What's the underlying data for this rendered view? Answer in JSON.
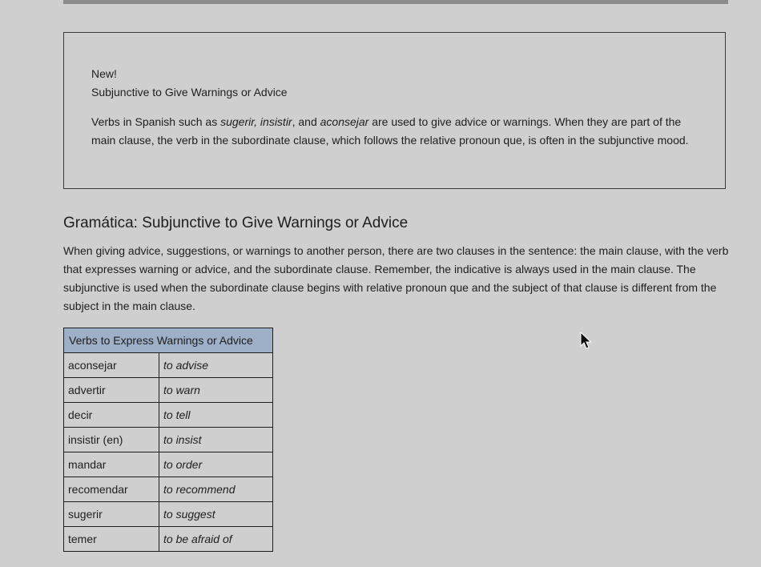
{
  "notice": {
    "badge": "New!",
    "title": "Subjunctive to Give Warnings or Advice",
    "body_intro": "Verbs in Spanish such as ",
    "verb1": "sugerir,",
    "sep1": " ",
    "verb2": "insistir",
    "sep2": ", and ",
    "verb3": "aconsejar",
    "body_mid": " are used to give advice or warnings. When they are part of the main clause, the verb in the subordinate clause, which follows the relative pronoun ",
    "pronoun": "que",
    "body_end": ", is often in the subjunctive mood."
  },
  "grammar": {
    "heading": "Gramática: Subjunctive to Give Warnings or Advice",
    "paragraph_start": "When giving advice, suggestions, or warnings to another person, there are two clauses in the sentence: the main clause, with the verb that expresses warning or advice, and the subordinate clause. Remember, the indicative is always used in the main clause. The subjunctive is used when the subordinate clause begins with relative pronoun ",
    "pronoun": "que",
    "paragraph_end": " and the subject of that clause is different from the subject in the main clause."
  },
  "table": {
    "header": "Verbs to Express Warnings or Advice",
    "rows": [
      {
        "spanish": "aconsejar",
        "english": "to advise"
      },
      {
        "spanish": "advertir",
        "english": "to warn"
      },
      {
        "spanish": "decir",
        "english": "to tell"
      },
      {
        "spanish": "insistir (en)",
        "english": "to insist"
      },
      {
        "spanish": "mandar",
        "english": "to order"
      },
      {
        "spanish": "recomendar",
        "english": "to recommend"
      },
      {
        "spanish": "sugerir",
        "english": "to suggest"
      },
      {
        "spanish": "temer",
        "english": "to be afraid of"
      }
    ]
  },
  "icons": {
    "cursor": "mouse-pointer-icon"
  }
}
